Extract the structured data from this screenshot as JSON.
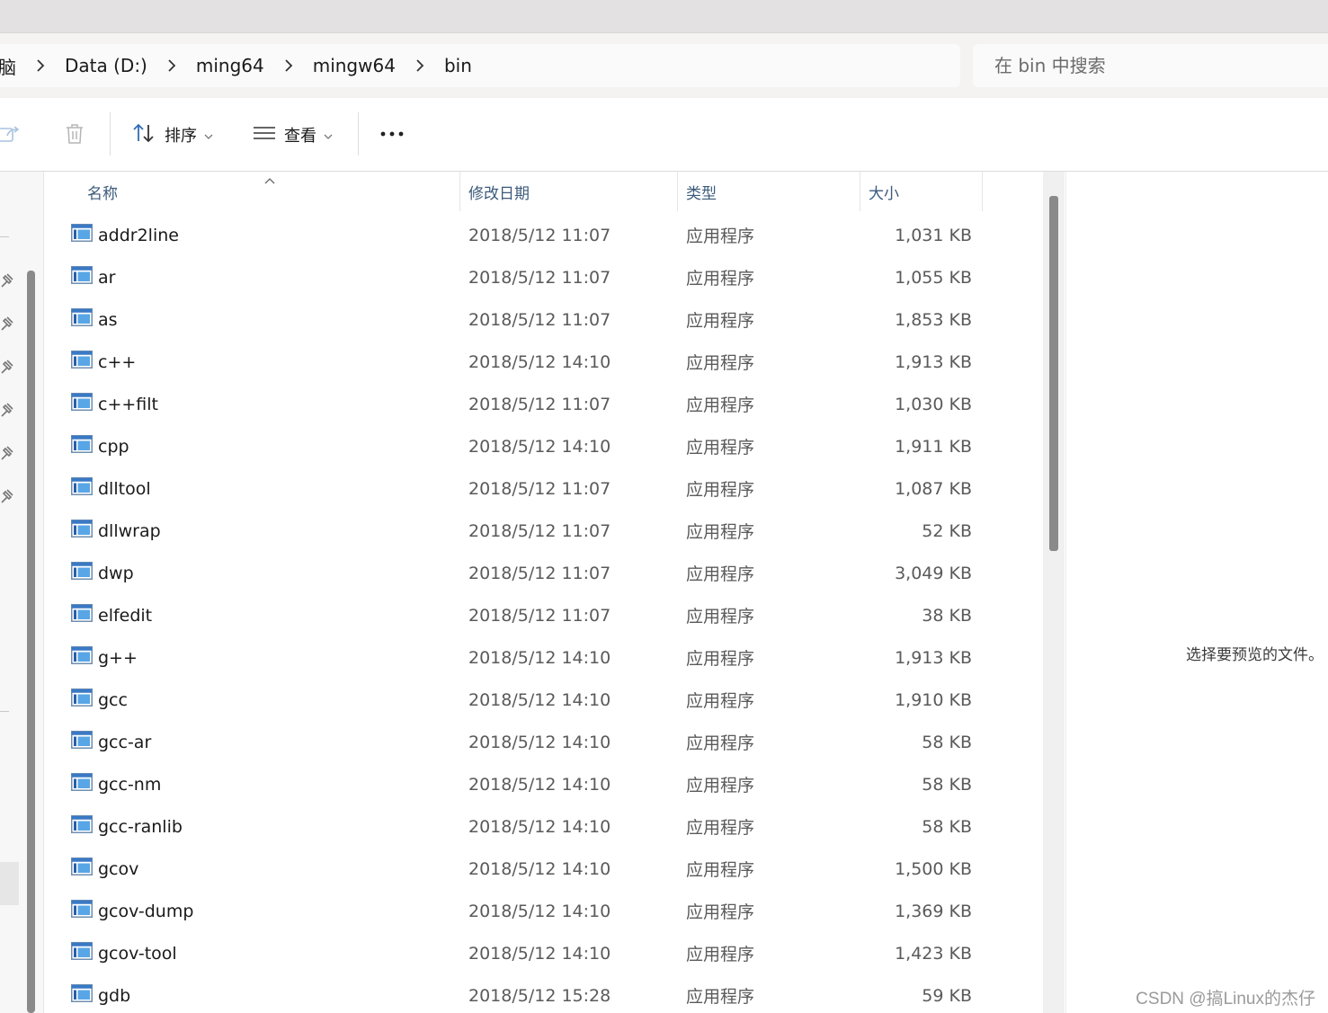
{
  "breadcrumb": {
    "items": [
      "脑",
      "Data (D:)",
      "ming64",
      "mingw64",
      "bin"
    ]
  },
  "search": {
    "placeholder": "在 bin 中搜索"
  },
  "toolbar": {
    "sort_label": "排序",
    "view_label": "查看",
    "share_icon": "share-icon",
    "delete_icon": "trash-icon",
    "more_icon": "more-icon"
  },
  "columns": {
    "name": "名称",
    "date": "修改日期",
    "type": "类型",
    "size": "大小"
  },
  "files": [
    {
      "name": "addr2line",
      "date": "2018/5/12 11:07",
      "type": "应用程序",
      "size": "1,031 KB"
    },
    {
      "name": "ar",
      "date": "2018/5/12 11:07",
      "type": "应用程序",
      "size": "1,055 KB"
    },
    {
      "name": "as",
      "date": "2018/5/12 11:07",
      "type": "应用程序",
      "size": "1,853 KB"
    },
    {
      "name": "c++",
      "date": "2018/5/12 14:10",
      "type": "应用程序",
      "size": "1,913 KB"
    },
    {
      "name": "c++filt",
      "date": "2018/5/12 11:07",
      "type": "应用程序",
      "size": "1,030 KB"
    },
    {
      "name": "cpp",
      "date": "2018/5/12 14:10",
      "type": "应用程序",
      "size": "1,911 KB"
    },
    {
      "name": "dlltool",
      "date": "2018/5/12 11:07",
      "type": "应用程序",
      "size": "1,087 KB"
    },
    {
      "name": "dllwrap",
      "date": "2018/5/12 11:07",
      "type": "应用程序",
      "size": "52 KB"
    },
    {
      "name": "dwp",
      "date": "2018/5/12 11:07",
      "type": "应用程序",
      "size": "3,049 KB"
    },
    {
      "name": "elfedit",
      "date": "2018/5/12 11:07",
      "type": "应用程序",
      "size": "38 KB"
    },
    {
      "name": "g++",
      "date": "2018/5/12 14:10",
      "type": "应用程序",
      "size": "1,913 KB"
    },
    {
      "name": "gcc",
      "date": "2018/5/12 14:10",
      "type": "应用程序",
      "size": "1,910 KB"
    },
    {
      "name": "gcc-ar",
      "date": "2018/5/12 14:10",
      "type": "应用程序",
      "size": "58 KB"
    },
    {
      "name": "gcc-nm",
      "date": "2018/5/12 14:10",
      "type": "应用程序",
      "size": "58 KB"
    },
    {
      "name": "gcc-ranlib",
      "date": "2018/5/12 14:10",
      "type": "应用程序",
      "size": "58 KB"
    },
    {
      "name": "gcov",
      "date": "2018/5/12 14:10",
      "type": "应用程序",
      "size": "1,500 KB"
    },
    {
      "name": "gcov-dump",
      "date": "2018/5/12 14:10",
      "type": "应用程序",
      "size": "1,369 KB"
    },
    {
      "name": "gcov-tool",
      "date": "2018/5/12 14:10",
      "type": "应用程序",
      "size": "1,423 KB"
    },
    {
      "name": "gdb",
      "date": "2018/5/12 15:28",
      "type": "应用程序",
      "size": "59 KB"
    }
  ],
  "preview": {
    "empty_text": "选择要预览的文件。"
  },
  "watermark": "CSDN @搞Linux的杰仔"
}
